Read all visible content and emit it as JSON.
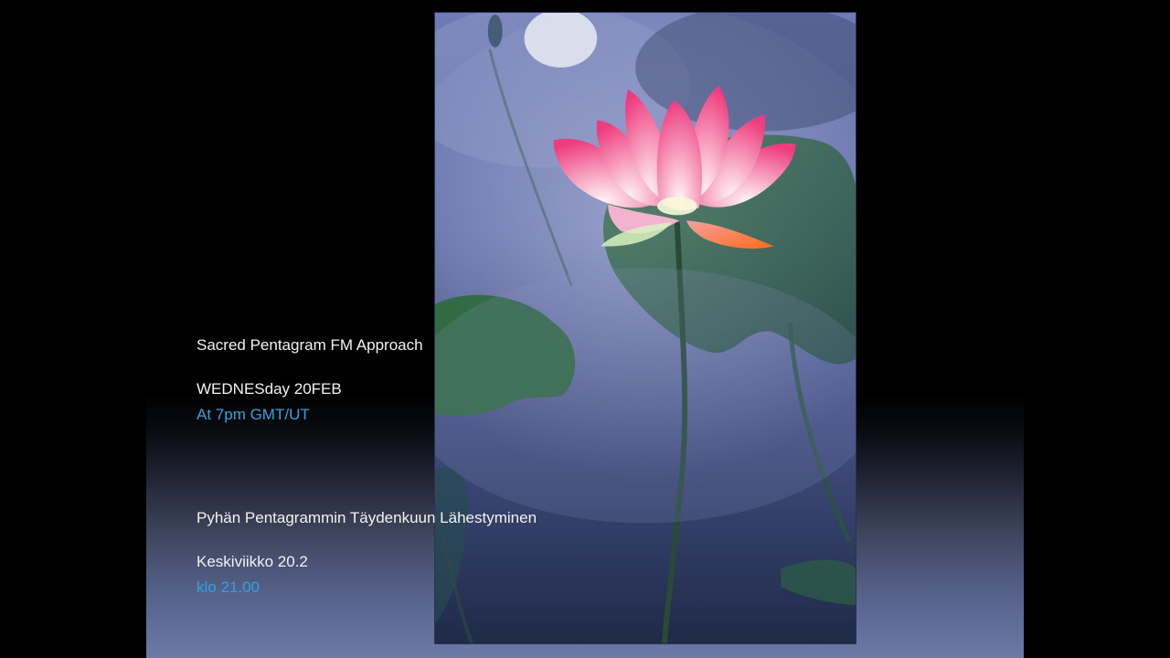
{
  "english": {
    "title": "Sacred Pentagram FM Approach",
    "day": "WEDNESday 20FEB",
    "time": "At 7pm GMT/UT"
  },
  "finnish": {
    "title": "Pyhän Pentagrammin Täydenkuun Lähestyminen",
    "day": "Keskiviikko 20.2",
    "time": "klo 21.00"
  },
  "image": {
    "subject": "pink lotus flower with green leaves in blue mist"
  },
  "colors": {
    "accent_text": "#2fa3e0",
    "main_text": "#f2f2f2",
    "lotus_pink": "#f0508a"
  }
}
